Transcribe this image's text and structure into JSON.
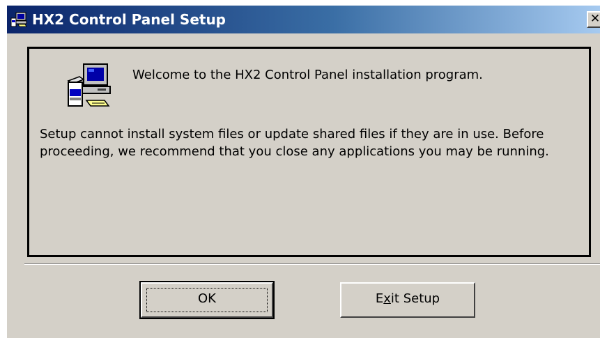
{
  "window": {
    "title": "HX2 Control Panel Setup",
    "close_glyph": "✕"
  },
  "panel": {
    "welcome": "Welcome to the HX2 Control Panel installation program.",
    "body": "Setup cannot install system files or update shared files if they are in use. Before proceeding, we recommend that you close any applications you may be running."
  },
  "buttons": {
    "ok_label": "OK",
    "exit_label_pre": "E",
    "exit_label_accel": "x",
    "exit_label_post": "it Setup"
  },
  "icons": {
    "title": "setup-computer-icon",
    "panel": "setup-computer-icon"
  },
  "colors": {
    "titlebar_start": "#0a246a",
    "titlebar_end": "#a6caf0",
    "face": "#d4d0c8"
  }
}
